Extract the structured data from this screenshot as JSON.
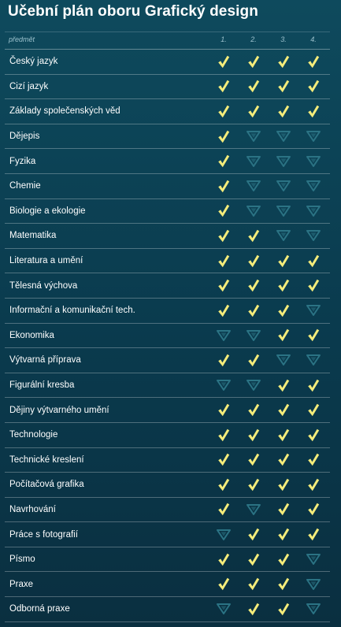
{
  "title": "Učební plán oboru Grafický design",
  "header": {
    "subject_label": "předmět",
    "years": [
      "1.",
      "2.",
      "3.",
      "4."
    ]
  },
  "colors": {
    "check": "#f4ec7a",
    "inactive": "#2b7384",
    "background_top": "#0e4a5d",
    "background_bottom": "#0a2f40"
  },
  "icons": {
    "active": "checkmark-icon",
    "inactive": "triangle-down-icon"
  },
  "rows": [
    {
      "subject": "Český jazyk",
      "years": [
        true,
        true,
        true,
        true
      ]
    },
    {
      "subject": "Cizí jazyk",
      "years": [
        true,
        true,
        true,
        true
      ]
    },
    {
      "subject": "Základy společenských věd",
      "years": [
        true,
        true,
        true,
        true
      ]
    },
    {
      "subject": "Dějepis",
      "years": [
        true,
        false,
        false,
        false
      ]
    },
    {
      "subject": "Fyzika",
      "years": [
        true,
        false,
        false,
        false
      ]
    },
    {
      "subject": "Chemie",
      "years": [
        true,
        false,
        false,
        false
      ]
    },
    {
      "subject": "Biologie a ekologie",
      "years": [
        true,
        false,
        false,
        false
      ]
    },
    {
      "subject": "Matematika",
      "years": [
        true,
        true,
        false,
        false
      ]
    },
    {
      "subject": "Literatura a umění",
      "years": [
        true,
        true,
        true,
        true
      ]
    },
    {
      "subject": "Tělesná výchova",
      "years": [
        true,
        true,
        true,
        true
      ]
    },
    {
      "subject": "Informační a komunikační tech.",
      "years": [
        true,
        true,
        true,
        false
      ]
    },
    {
      "subject": "Ekonomika",
      "years": [
        false,
        false,
        true,
        true
      ]
    },
    {
      "subject": "Výtvarná příprava",
      "years": [
        true,
        true,
        false,
        false
      ]
    },
    {
      "subject": "Figurální kresba",
      "years": [
        false,
        false,
        true,
        true
      ]
    },
    {
      "subject": "Dějiny výtvarného umění",
      "years": [
        true,
        true,
        true,
        true
      ]
    },
    {
      "subject": "Technologie",
      "years": [
        true,
        true,
        true,
        true
      ]
    },
    {
      "subject": "Technické kreslení",
      "years": [
        true,
        true,
        true,
        true
      ]
    },
    {
      "subject": "Počítačová grafika",
      "years": [
        true,
        true,
        true,
        true
      ]
    },
    {
      "subject": "Navrhování",
      "years": [
        true,
        false,
        true,
        true
      ]
    },
    {
      "subject": "Práce s fotografií",
      "years": [
        false,
        true,
        true,
        true
      ]
    },
    {
      "subject": "Písmo",
      "years": [
        true,
        true,
        true,
        false
      ]
    },
    {
      "subject": "Praxe",
      "years": [
        true,
        true,
        true,
        false
      ]
    },
    {
      "subject": "Odborná praxe",
      "years": [
        false,
        true,
        true,
        false
      ]
    }
  ]
}
